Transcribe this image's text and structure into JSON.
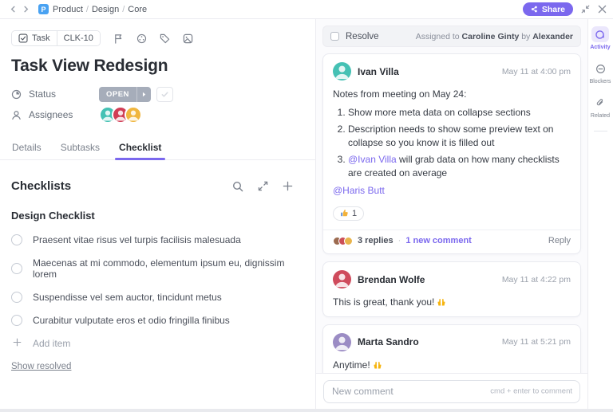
{
  "topbar": {
    "breadcrumb": {
      "space_initial": "P",
      "sep": "/",
      "items": [
        "Product",
        "Design",
        "Core"
      ]
    },
    "share_label": "Share"
  },
  "task": {
    "type_label": "Task",
    "id": "CLK-10",
    "title": "Task View Redesign",
    "status": {
      "label": "Status",
      "value": "OPEN"
    },
    "assignees": {
      "label": "Assignees",
      "avatar_colors": [
        "#45c1b4",
        "#d03d55",
        "#f0b63f"
      ]
    },
    "tabs": [
      {
        "label": "Details"
      },
      {
        "label": "Subtasks"
      },
      {
        "label": "Checklist"
      }
    ],
    "active_tab": "Checklist"
  },
  "checklists": {
    "title": "Checklists",
    "group_title": "Design Checklist",
    "items": [
      "Praesent vitae risus vel turpis facilisis malesuada",
      "Maecenas at mi commodo, elementum ipsum eu, dignissim lorem",
      "Suspendisse vel sem auctor, tincidunt metus",
      "Curabitur vulputate eros et odio fringilla finibus"
    ],
    "add_item_label": "Add item",
    "show_resolved_label": "Show resolved"
  },
  "comments": {
    "resolve_label": "Resolve",
    "assigned": {
      "prefix": "Assigned to",
      "assignee": "Caroline Ginty",
      "by": "by",
      "assigner": "Alexander"
    },
    "thread": [
      {
        "author": "Ivan Villa",
        "time": "May 11 at 4:00 pm",
        "avatar_color": "#45c1b4",
        "intro": "Notes from meeting on May 24:",
        "list": [
          {
            "text": "Show more meta data on collapse sections"
          },
          {
            "text": "Description needs to show some preview text on collapse so you know it is filled out"
          },
          {
            "mention": "@Ivan Villa",
            "text": " will grab data on how many checklists are created on average"
          }
        ],
        "footer_mention": "@Haris Butt",
        "reaction": {
          "emoji": "👍",
          "count": "1"
        },
        "replies": {
          "label": "3 replies",
          "new_label": "1 new comment",
          "reply_label": "Reply",
          "avatar_colors": [
            "#9c6b50",
            "#cc4f58",
            "#e9b44c"
          ]
        }
      },
      {
        "author": "Brendan Wolfe",
        "time": "May 11 at 4:22 pm",
        "avatar_color": "#cf4b5c",
        "text": "This is great, thank you!",
        "emoji": "🙌"
      },
      {
        "author": "Marta Sandro",
        "time": "May 11 at 5:21 pm",
        "avatar_color": "#9b8cc4",
        "text": "Anytime!",
        "emoji": "🙌"
      }
    ],
    "composer": {
      "placeholder": "New comment",
      "hint": "cmd + enter to comment"
    }
  },
  "rail": {
    "items": [
      {
        "label": "Activity"
      },
      {
        "label": "Blockers"
      },
      {
        "label": "Related"
      }
    ]
  },
  "colors": {
    "accent": "#7b68ee",
    "status_badge": "#a6adba",
    "space_badge": "#49a2f2"
  }
}
